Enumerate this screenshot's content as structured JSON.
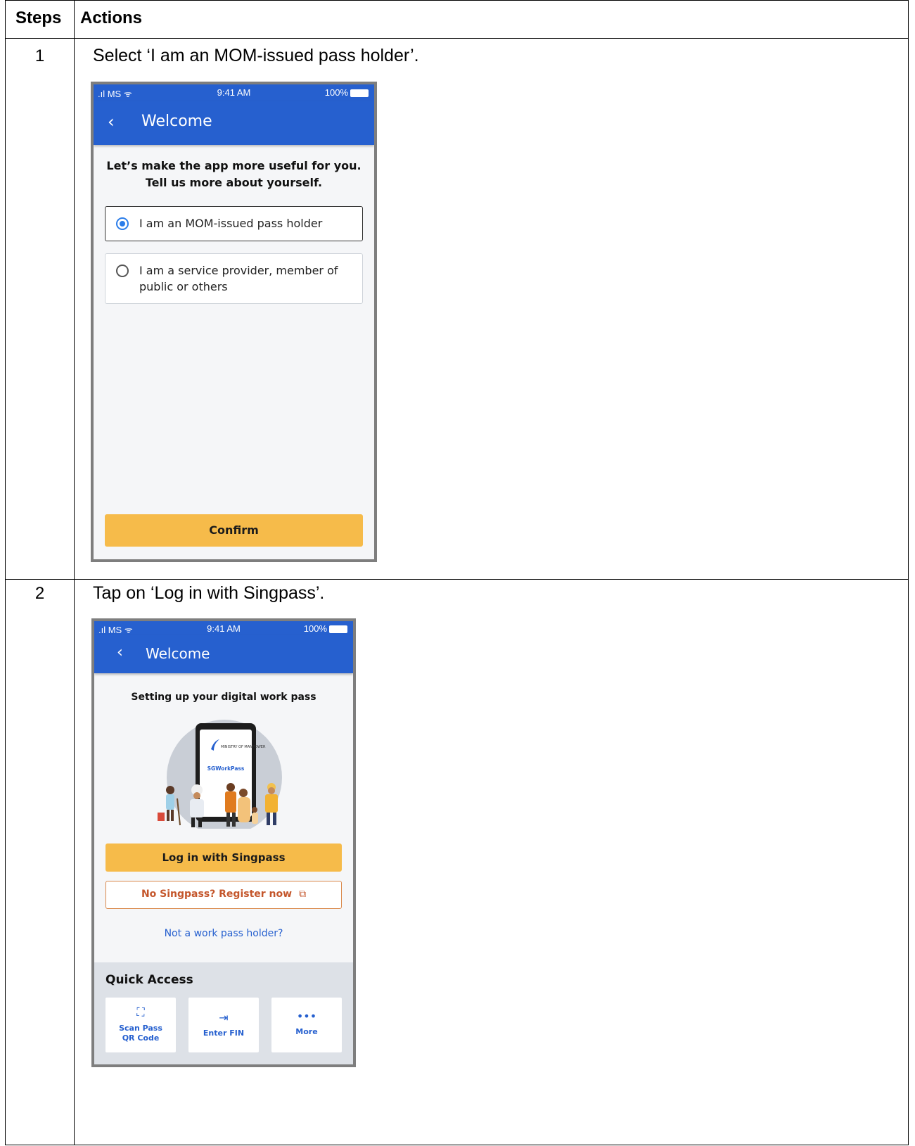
{
  "table": {
    "headers": {
      "steps": "Steps",
      "actions": "Actions"
    },
    "rows": [
      {
        "step": "1",
        "instruction": "Select ‘I am an MOM-issued pass holder’."
      },
      {
        "step": "2",
        "instruction": "Tap on ‘Log in with Singpass’."
      }
    ]
  },
  "screen1": {
    "status": {
      "signal": ".ıl MS ᯤ",
      "time": "9:41 AM",
      "battery": "100%"
    },
    "appbar": {
      "back": "‹",
      "title": "Welcome"
    },
    "intro_line1": "Let’s make the app more useful for you.",
    "intro_line2": "Tell us more about yourself.",
    "option1": "I am an MOM-issued pass holder",
    "option2": "I am a service provider, member of public or others",
    "confirm": "Confirm"
  },
  "screen2": {
    "status": {
      "signal": ".ıl MS ᯤ",
      "time": "9:41 AM",
      "battery": "100%"
    },
    "appbar": {
      "back": "‹",
      "title": "Welcome"
    },
    "subtitle": "Setting up your digital work pass",
    "illustration": {
      "logo_text": "MINISTRY OF MANPOWER",
      "app_name": "SGWorkPass"
    },
    "login": "Log in with Singpass",
    "register": "No Singpass? Register now",
    "not_holder": "Not a work pass holder?",
    "quick_access": {
      "title": "Quick Access",
      "tiles": [
        {
          "icon": "scan-qr-icon",
          "label": "Scan Pass QR Code"
        },
        {
          "icon": "enter-fin-icon",
          "label": "Enter FIN"
        },
        {
          "icon": "more-icon",
          "label": "More"
        }
      ]
    }
  },
  "colors": {
    "appbar": "#2660cf",
    "primary_button": "#f6bb4a",
    "outline_button": "#c4562b",
    "radio": "#2b7de9"
  }
}
